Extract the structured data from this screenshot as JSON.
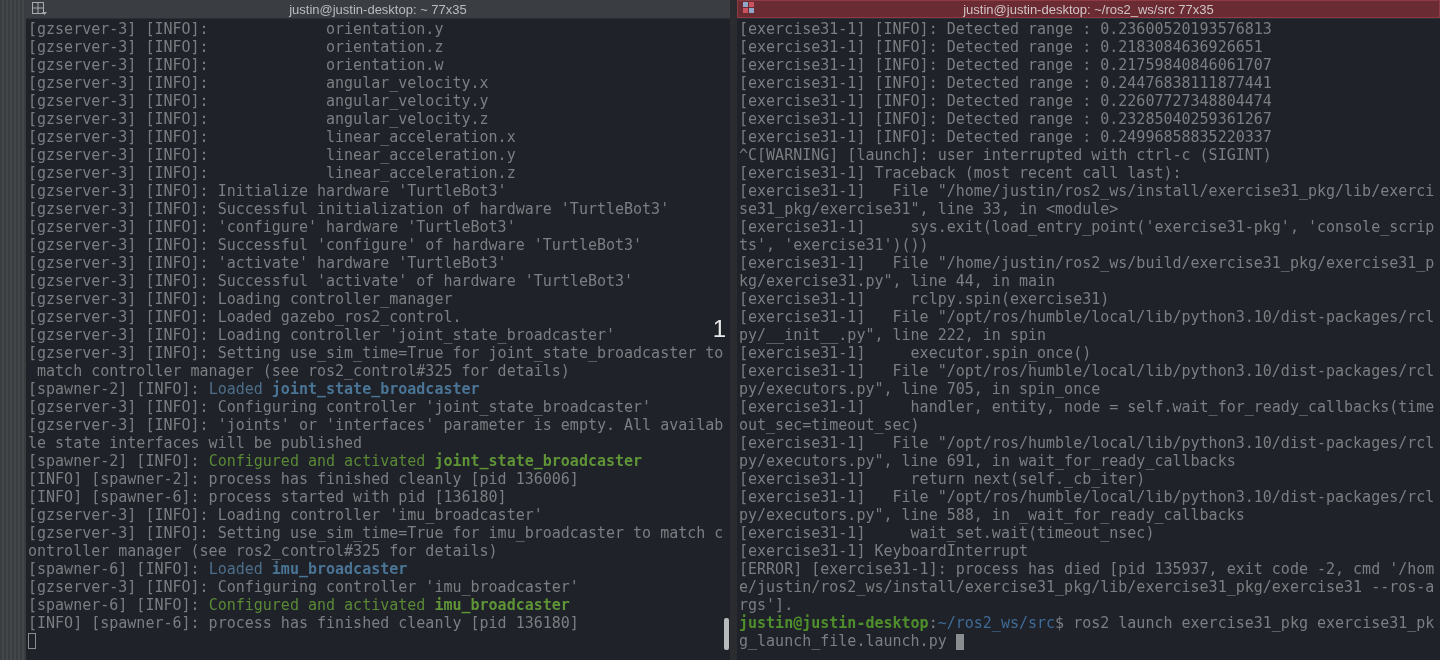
{
  "terminals": [
    {
      "title": "justin@justin-desktop: ~ 77x35",
      "focused": false,
      "cursor_on_new_line": true,
      "overlay_label": "1",
      "lines": [
        {
          "text": "[gzserver-3] [INFO]:             orientation.y"
        },
        {
          "text": "[gzserver-3] [INFO]:             orientation.z"
        },
        {
          "text": "[gzserver-3] [INFO]:             orientation.w"
        },
        {
          "text": "[gzserver-3] [INFO]:             angular_velocity.x"
        },
        {
          "text": "[gzserver-3] [INFO]:             angular_velocity.y"
        },
        {
          "text": "[gzserver-3] [INFO]:             angular_velocity.z"
        },
        {
          "text": "[gzserver-3] [INFO]:             linear_acceleration.x"
        },
        {
          "text": "[gzserver-3] [INFO]:             linear_acceleration.y"
        },
        {
          "text": "[gzserver-3] [INFO]:             linear_acceleration.z"
        },
        {
          "text": "[gzserver-3] [INFO]: Initialize hardware 'TurtleBot3'"
        },
        {
          "text": "[gzserver-3] [INFO]: Successful initialization of hardware 'TurtleBot3'"
        },
        {
          "text": "[gzserver-3] [INFO]: 'configure' hardware 'TurtleBot3'"
        },
        {
          "text": "[gzserver-3] [INFO]: Successful 'configure' of hardware 'TurtleBot3'"
        },
        {
          "text": "[gzserver-3] [INFO]: 'activate' hardware 'TurtleBot3'"
        },
        {
          "text": "[gzserver-3] [INFO]: Successful 'activate' of hardware 'TurtleBot3'"
        },
        {
          "text": "[gzserver-3] [INFO]: Loading controller_manager"
        },
        {
          "text": "[gzserver-3] [INFO]: Loaded gazebo_ros2_control."
        },
        {
          "text": "[gzserver-3] [INFO]: Loading controller 'joint_state_broadcaster'"
        },
        {
          "text": "[gzserver-3] [INFO]: Setting use_sim_time=True for joint_state_broadcaster to"
        },
        {
          "text": " match controller manager (see ros2_control#325 for details)"
        },
        {
          "segments": [
            {
              "text": "[spawner-2] [INFO]: ",
              "kind": "plain"
            },
            {
              "text": "Loaded ",
              "kind": "info"
            },
            {
              "text": "joint_state_broadcaster",
              "kind": "infobold"
            }
          ]
        },
        {
          "text": "[gzserver-3] [INFO]: Configuring controller 'joint_state_broadcaster'"
        },
        {
          "text": "[gzserver-3] [INFO]: 'joints' or 'interfaces' parameter is empty. All availab"
        },
        {
          "text": "le state interfaces will be published"
        },
        {
          "segments": [
            {
              "text": "[spawner-2] [INFO]: ",
              "kind": "plain"
            },
            {
              "text": "Configured and activated ",
              "kind": "ok"
            },
            {
              "text": "joint_state_broadcaster",
              "kind": "okbold"
            }
          ]
        },
        {
          "text": "[INFO] [spawner-2]: process has finished cleanly [pid 136006]"
        },
        {
          "text": "[INFO] [spawner-6]: process started with pid [136180]"
        },
        {
          "text": "[gzserver-3] [INFO]: Loading controller 'imu_broadcaster'"
        },
        {
          "text": "[gzserver-3] [INFO]: Setting use_sim_time=True for imu_broadcaster to match c"
        },
        {
          "text": "ontroller manager (see ros2_control#325 for details)"
        },
        {
          "segments": [
            {
              "text": "[spawner-6] [INFO]: ",
              "kind": "plain"
            },
            {
              "text": "Loaded ",
              "kind": "info"
            },
            {
              "text": "imu_broadcaster",
              "kind": "infobold"
            }
          ]
        },
        {
          "text": "[gzserver-3] [INFO]: Configuring controller 'imu_broadcaster'"
        },
        {
          "segments": [
            {
              "text": "[spawner-6] [INFO]: ",
              "kind": "plain"
            },
            {
              "text": "Configured and activated ",
              "kind": "ok"
            },
            {
              "text": "imu_broadcaster",
              "kind": "okbold"
            }
          ]
        },
        {
          "text": "[INFO] [spawner-6]: process has finished cleanly [pid 136180]"
        }
      ]
    },
    {
      "title": "justin@justin-desktop: ~/ros2_ws/src 77x35",
      "focused": true,
      "cursor_on_new_line": false,
      "lines": [
        {
          "text": "[exercise31-1] [INFO]: Detected range : 0.23600520193576813"
        },
        {
          "text": "[exercise31-1] [INFO]: Detected range : 0.2183084636926651"
        },
        {
          "text": "[exercise31-1] [INFO]: Detected range : 0.21759840846061707"
        },
        {
          "text": "[exercise31-1] [INFO]: Detected range : 0.24476838111877441"
        },
        {
          "text": "[exercise31-1] [INFO]: Detected range : 0.22607727348804474"
        },
        {
          "text": "[exercise31-1] [INFO]: Detected range : 0.23285040259361267"
        },
        {
          "text": "[exercise31-1] [INFO]: Detected range : 0.24996858835220337"
        },
        {
          "text": "^C[WARNING] [launch]: user interrupted with ctrl-c (SIGINT)"
        },
        {
          "text": "[exercise31-1] Traceback (most recent call last):"
        },
        {
          "text": "[exercise31-1]   File \"/home/justin/ros2_ws/install/exercise31_pkg/lib/exerci"
        },
        {
          "text": "se31_pkg/exercise31\", line 33, in <module>"
        },
        {
          "text": "[exercise31-1]     sys.exit(load_entry_point('exercise31-pkg', 'console_scrip"
        },
        {
          "text": "ts', 'exercise31')())"
        },
        {
          "text": "[exercise31-1]   File \"/home/justin/ros2_ws/build/exercise31_pkg/exercise31_p"
        },
        {
          "text": "kg/exercise31.py\", line 44, in main"
        },
        {
          "text": "[exercise31-1]     rclpy.spin(exercise31)"
        },
        {
          "text": "[exercise31-1]   File \"/opt/ros/humble/local/lib/python3.10/dist-packages/rcl"
        },
        {
          "text": "py/__init__.py\", line 222, in spin"
        },
        {
          "text": "[exercise31-1]     executor.spin_once()"
        },
        {
          "text": "[exercise31-1]   File \"/opt/ros/humble/local/lib/python3.10/dist-packages/rcl"
        },
        {
          "text": "py/executors.py\", line 705, in spin_once"
        },
        {
          "text": "[exercise31-1]     handler, entity, node = self.wait_for_ready_callbacks(time"
        },
        {
          "text": "out_sec=timeout_sec)"
        },
        {
          "text": "[exercise31-1]   File \"/opt/ros/humble/local/lib/python3.10/dist-packages/rcl"
        },
        {
          "text": "py/executors.py\", line 691, in wait_for_ready_callbacks"
        },
        {
          "text": "[exercise31-1]     return next(self._cb_iter)"
        },
        {
          "text": "[exercise31-1]   File \"/opt/ros/humble/local/lib/python3.10/dist-packages/rcl"
        },
        {
          "text": "py/executors.py\", line 588, in _wait_for_ready_callbacks"
        },
        {
          "text": "[exercise31-1]     wait_set.wait(timeout_nsec)"
        },
        {
          "text": "[exercise31-1] KeyboardInterrupt"
        },
        {
          "text": "[ERROR] [exercise31-1]: process has died [pid 135937, exit code -2, cmd '/hom"
        },
        {
          "text": "e/justin/ros2_ws/install/exercise31_pkg/lib/exercise31_pkg/exercise31 --ros-a"
        },
        {
          "text": "rgs']."
        },
        {
          "segments": [
            {
              "text": "justin@justin-desktop",
              "kind": "user"
            },
            {
              "text": ":",
              "kind": "plain"
            },
            {
              "text": "~/ros2_ws/src",
              "kind": "path"
            },
            {
              "text": "$ ros2 launch exercise31_pkg exercise31_pk",
              "kind": "plain"
            }
          ]
        },
        {
          "text": "g_launch_file.launch.py "
        }
      ]
    }
  ]
}
